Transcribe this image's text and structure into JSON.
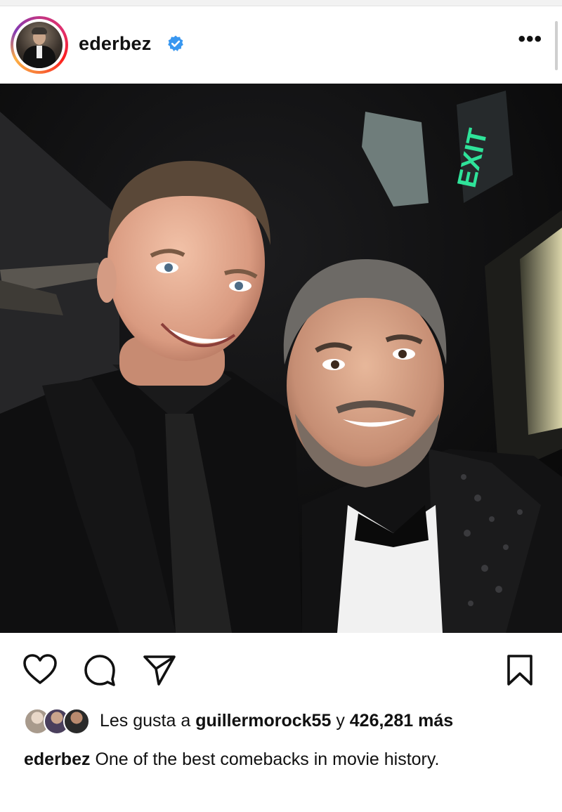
{
  "post": {
    "username": "ederbez",
    "verified": true,
    "icons": {
      "avatar": "profile-avatar",
      "verified": "verified-badge-icon",
      "more": "more-options-icon",
      "like": "heart-icon",
      "comment": "comment-icon",
      "share": "send-icon",
      "save": "bookmark-icon"
    },
    "photo": {
      "exit_sign": "EXIT"
    },
    "likes": {
      "prefix": "Les gusta a",
      "user": "guillermorock55",
      "connector": "y",
      "count": "426,281",
      "suffix": "más"
    },
    "caption": {
      "user": "ederbez",
      "text": "One of the best comebacks in movie history."
    },
    "colors": {
      "verified_blue": "#3897f0",
      "exit_green": "#2fe39a",
      "text": "#111111"
    }
  }
}
